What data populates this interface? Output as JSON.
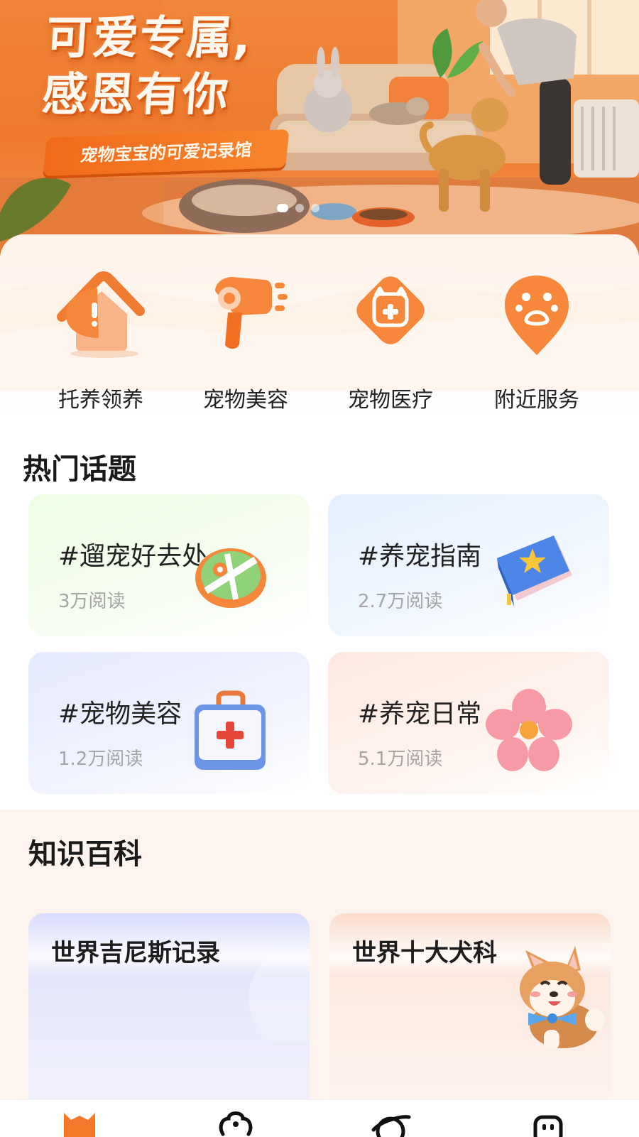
{
  "banner": {
    "title": "可爱专属,\n感恩有你",
    "subtitle": "宠物宝宝的可爱记录馆",
    "slide_count": 3,
    "active_slide": 1
  },
  "services": [
    {
      "label": "托养领养",
      "icon": "pet-house-icon"
    },
    {
      "label": "宠物美容",
      "icon": "hair-dryer-icon"
    },
    {
      "label": "宠物医疗",
      "icon": "pet-medical-icon"
    },
    {
      "label": "附近服务",
      "icon": "location-paw-icon"
    }
  ],
  "hot_topics": {
    "title": "热门话题",
    "items": [
      {
        "title": "#遛宠好去处",
        "reads": "3万阅读",
        "icon": "map-icon"
      },
      {
        "title": "#养宠指南",
        "reads": "2.7万阅读",
        "icon": "book-icon"
      },
      {
        "title": "#宠物美容",
        "reads": "1.2万阅读",
        "icon": "medical-kit-icon"
      },
      {
        "title": "#养宠日常",
        "reads": "5.1万阅读",
        "icon": "flower-icon"
      }
    ]
  },
  "knowledge": {
    "title": "知识百科",
    "items": [
      {
        "title": "世界吉尼斯记录"
      },
      {
        "title": "世界十大犬科",
        "icon": "corgi-icon"
      }
    ]
  },
  "tabbar": [
    {
      "icon": "cat-home-icon",
      "active": true
    },
    {
      "icon": "flower-paw-icon"
    },
    {
      "icon": "planet-icon"
    },
    {
      "icon": "profile-icon"
    }
  ],
  "colors": {
    "accent": "#f5792a",
    "brand_orange": "#ee7a2c"
  }
}
